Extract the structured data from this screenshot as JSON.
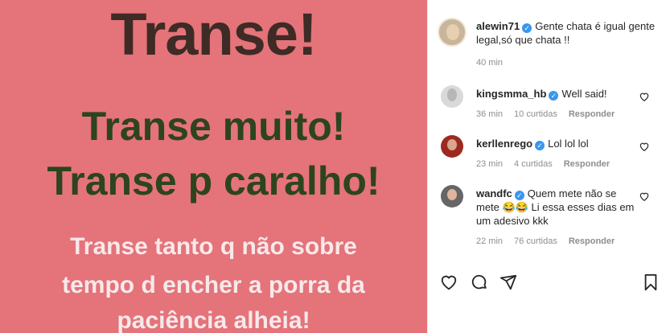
{
  "post": {
    "image_lines": [
      "Transe!",
      "Transe muito!",
      "Transe p caralho!",
      "Transe tanto q não sobre",
      "tempo d encher a porra da",
      "paciência alheia!"
    ]
  },
  "caption": {
    "username": "alewin71",
    "text_line1": "Gente chata é igual gente",
    "text_line2": "legal,só que chata !!",
    "time": "40 min"
  },
  "comments": [
    {
      "username": "kingsmma_hb",
      "text": "Well said!",
      "time": "36 min",
      "likes": "10 curtidas",
      "reply": "Responder"
    },
    {
      "username": "kerllenrego",
      "text": "Lol lol lol",
      "time": "23 min",
      "likes": "4 curtidas",
      "reply": "Responder"
    },
    {
      "username": "wandfc",
      "text_line1": "Quem mete não se",
      "text_line2": "mete 😂😂 Li essa esses dias em",
      "text_line3": "um adesivo kkk",
      "time": "22 min",
      "likes": "76 curtidas",
      "reply": "Responder"
    }
  ],
  "icons": [
    "heart-icon",
    "comment-icon",
    "share-icon",
    "bookmark-icon"
  ],
  "colors": {
    "verified": "#3897f0",
    "image_bg": "#e5737a",
    "dark_text": "#3e2b25",
    "green_text": "#2d4420"
  }
}
